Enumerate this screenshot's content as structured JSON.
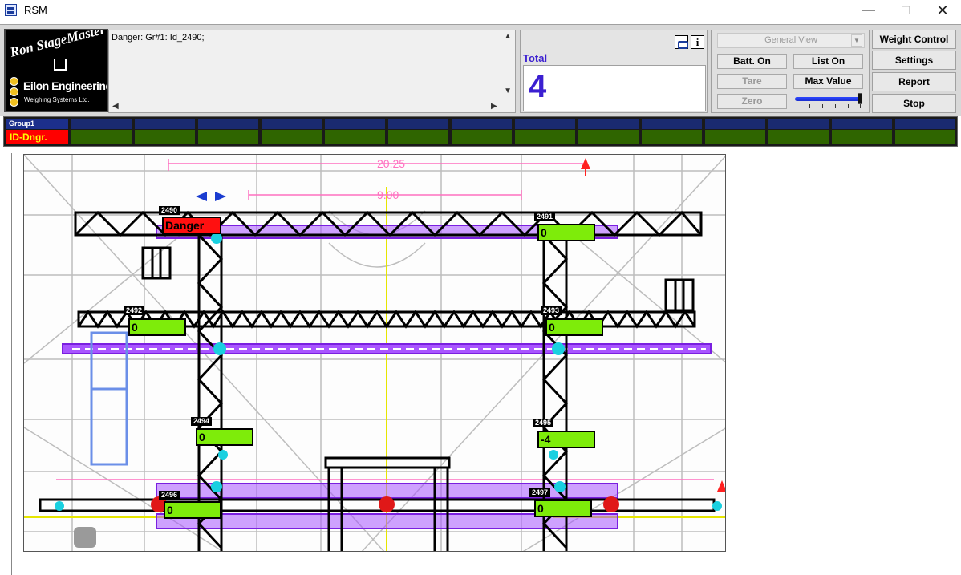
{
  "window": {
    "title": "RSM"
  },
  "logo": {
    "brand": "Ron StageMaster",
    "company": "Eilon Engineering",
    "subtitle": "Weighing Systems Ltd."
  },
  "messages": {
    "text": "Danger: Gr#1:  Id_2490;"
  },
  "total": {
    "label": "Total",
    "value": "4"
  },
  "controls": {
    "view_select": "General View",
    "batt_on": "Batt. On",
    "list_on": "List On",
    "tare": "Tare",
    "max_value": "Max Value",
    "zero": "Zero",
    "slider_level": 0.97
  },
  "side_buttons": {
    "weight_control": "Weight Control",
    "settings": "Settings",
    "report": "Report",
    "stop": "Stop"
  },
  "group": {
    "name": "Group1",
    "status": "ID-Dngr.",
    "cell_count": 14
  },
  "drawing": {
    "dimensions": [
      "20.25",
      "9.00"
    ],
    "sensors": [
      {
        "id": "2490",
        "value": "Danger",
        "state": "danger"
      },
      {
        "id": "2491",
        "value": "0",
        "state": "ok"
      },
      {
        "id": "2492",
        "value": "0",
        "state": "ok"
      },
      {
        "id": "2493",
        "value": "0",
        "state": "ok"
      },
      {
        "id": "2494",
        "value": "0",
        "state": "ok"
      },
      {
        "id": "2495",
        "value": "-4",
        "state": "ok"
      },
      {
        "id": "2496",
        "value": "0",
        "state": "ok"
      },
      {
        "id": "2497",
        "value": "0",
        "state": "ok"
      }
    ]
  },
  "colors": {
    "accent": "#3b1fd1",
    "ok": "#7eec0a",
    "danger": "#ff1010",
    "group_bar": "#1a2a70",
    "group_ok": "#2f6500"
  }
}
